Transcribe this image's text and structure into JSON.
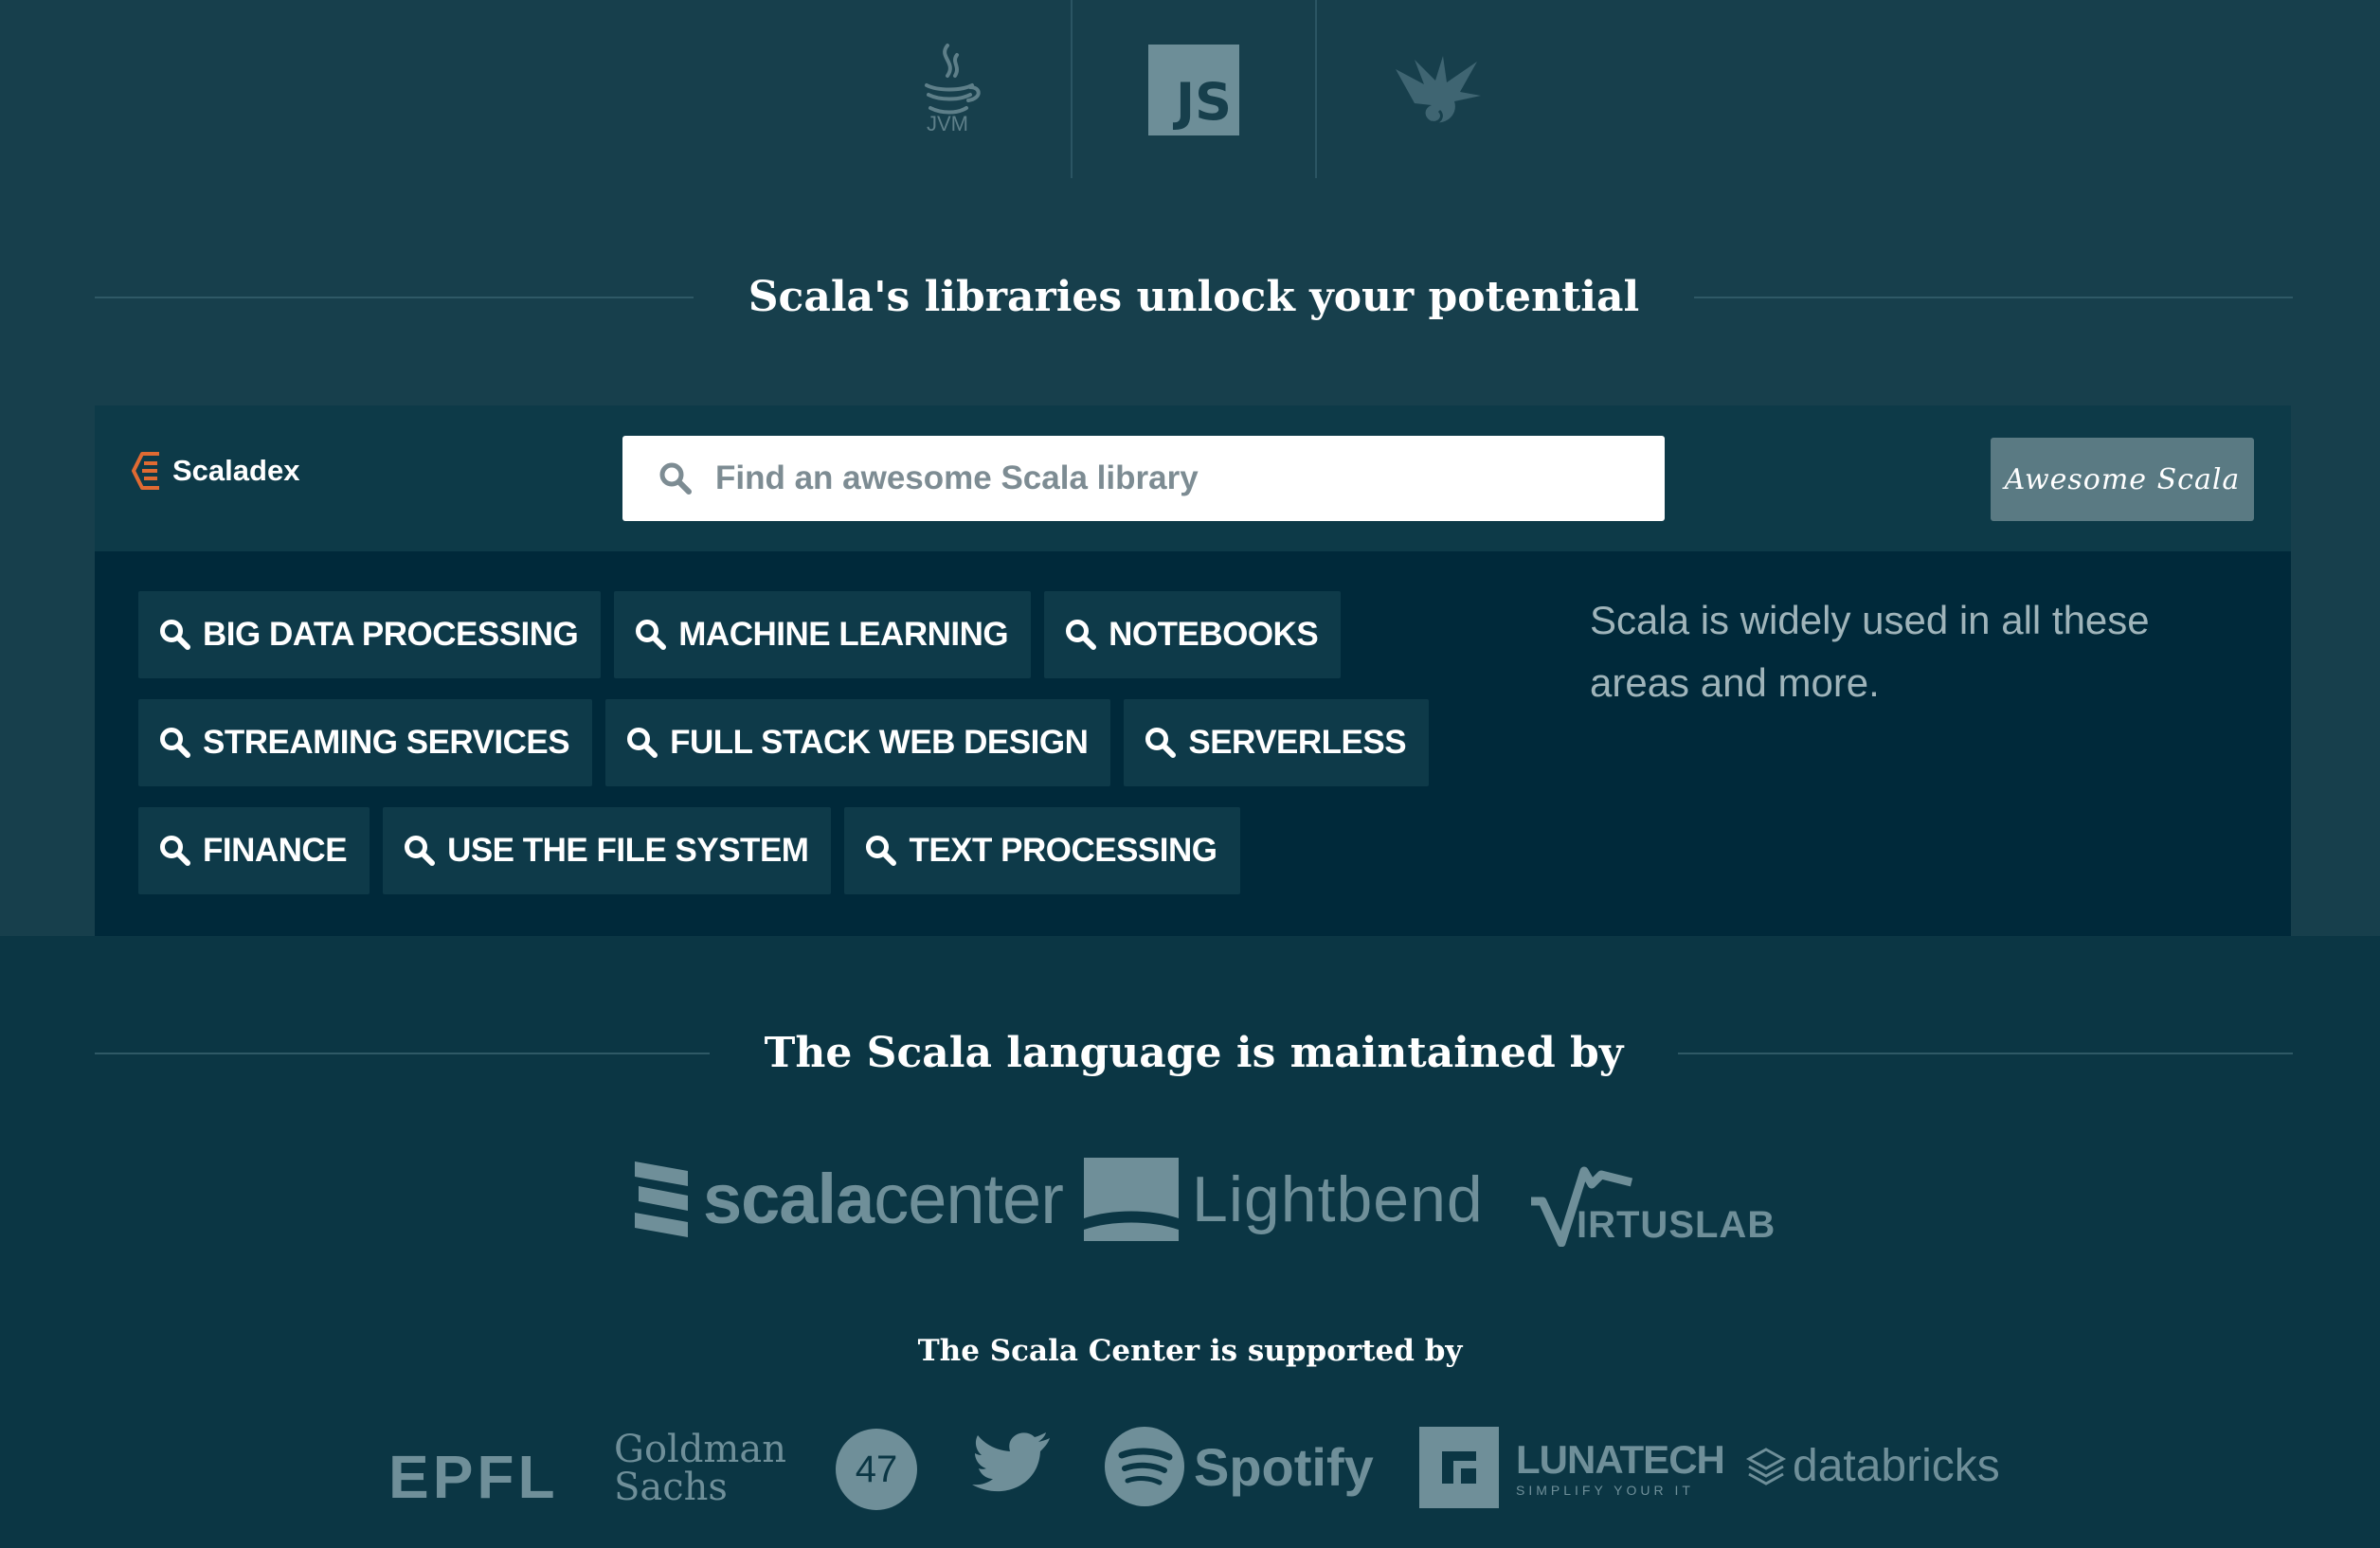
{
  "platforms": {
    "jvm_label": "JVM",
    "js_label": "JS",
    "active": "js"
  },
  "libraries": {
    "heading": "Scala's libraries unlock your potential",
    "scaladex_name": "Scaladex",
    "search_placeholder": "Find an awesome Scala library",
    "awesome_button": "Awesome Scala",
    "areas_text": "Scala is widely used in all these areas and more.",
    "tags": [
      [
        "BIG DATA PROCESSING",
        "MACHINE LEARNING",
        "NOTEBOOKS"
      ],
      [
        "STREAMING SERVICES",
        "FULL STACK WEB DESIGN",
        "SERVERLESS"
      ],
      [
        "FINANCE",
        "USE THE FILE SYSTEM",
        "TEXT PROCESSING"
      ]
    ]
  },
  "maintainers": {
    "heading": "The Scala language is maintained by",
    "logos": {
      "scalacenter_bold": "scala",
      "scalacenter_light": "center",
      "lightbend": "Lightbend",
      "virtuslab": "IRTUSLAB"
    }
  },
  "supporters": {
    "heading": "The Scala Center is supported by",
    "epfl": "EPFL",
    "goldman_line1": "Goldman",
    "goldman_line2": "Sachs",
    "fortyseven": "47",
    "spotify": "Spotify",
    "lunatech": "LUNATECH",
    "lunatech_tagline": "SIMPLIFY YOUR IT",
    "databricks": "databricks"
  },
  "colors": {
    "background": "#0b3644",
    "band": "#173f4c",
    "accent_orange": "#e06a32",
    "logo_gray": "#6f8f99"
  }
}
